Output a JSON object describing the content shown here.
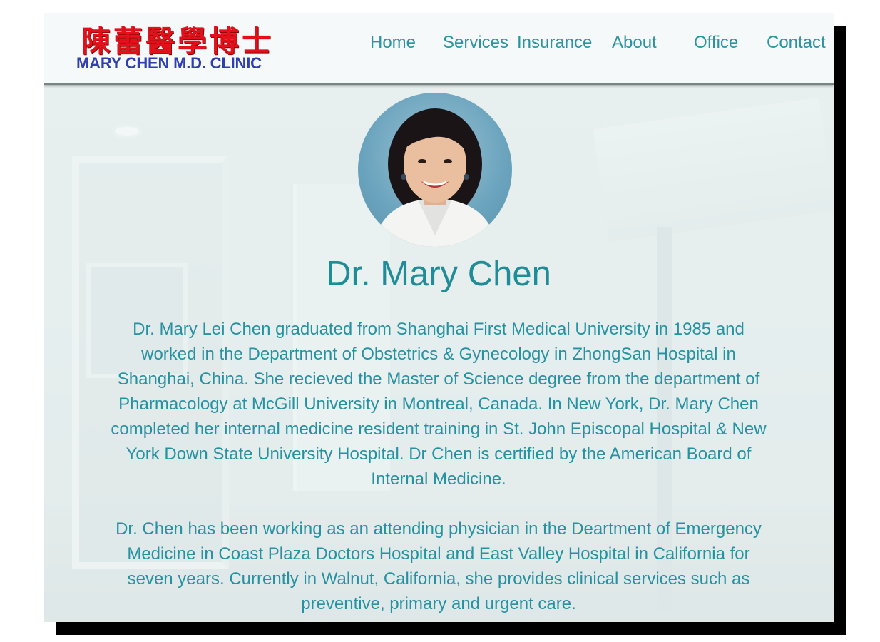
{
  "logo": {
    "chinese": "陳蕾醫學博士",
    "english": "MARY CHEN M.D. CLINIC"
  },
  "nav": {
    "items": [
      {
        "label": "Home"
      },
      {
        "label": "Services"
      },
      {
        "label": "Insurance"
      },
      {
        "label": "About"
      },
      {
        "label": "Office"
      },
      {
        "label": "Contact"
      }
    ]
  },
  "profile": {
    "name": "Dr. Mary Chen",
    "paragraphs": [
      "Dr. Mary Lei Chen graduated from Shanghai First Medical University in 1985 and worked in the Department of Obstetrics & Gynecology in ZhongSan Hospital in Shanghai, China. She recieved the Master of Science degree from the department of Pharmacology at McGill University in Montreal, Canada. In New York, Dr. Mary Chen completed her internal medicine resident training in St. John Episcopal Hospital & New York Down State University Hospital. Dr Chen is certified by the American Board of Internal Medicine.",
      "Dr. Chen has been working as an attending physician in the Deartment of Emergency Medicine in Coast Plaza Doctors Hospital and East Valley Hospital in California for seven years. Currently in Walnut, California, she provides clinical services such as preventive, primary and urgent care."
    ]
  },
  "colors": {
    "accent": "#1f8c98",
    "logo_red": "#e1101a",
    "logo_blue": "#2f3fb0"
  }
}
